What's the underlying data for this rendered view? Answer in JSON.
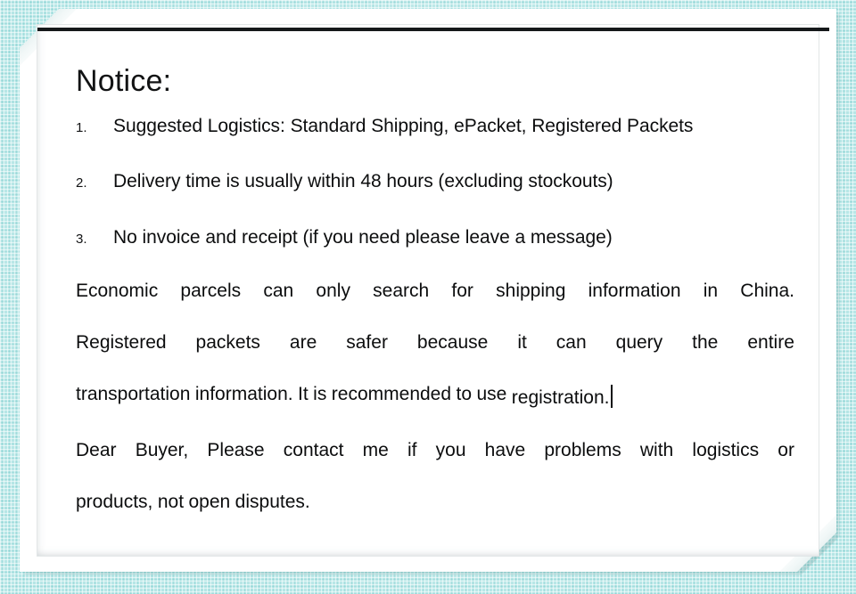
{
  "background": {
    "color": "#b6e6e6",
    "texture": "woven-grid"
  },
  "card": {
    "color": "#ffffff",
    "corner_style": "chamfered-top-left-bottom-right"
  },
  "divider": {
    "color": "#15181a"
  },
  "notice": {
    "title": "Notice:",
    "numbered_items": [
      {
        "marker": "1.",
        "text": "Suggested Logistics: Standard Shipping, ePacket, Registered Packets"
      },
      {
        "marker": "2.",
        "text": "Delivery time is usually within 48 hours (excluding stockouts)"
      },
      {
        "marker": "3.",
        "text": "No invoice and receipt (if you need please leave a message)"
      }
    ],
    "paragraph_lines": [
      {
        "align": "justify",
        "words": [
          "Economic",
          "parcels",
          "can",
          "only",
          "search",
          "for",
          "shipping",
          "information",
          "in",
          "China."
        ]
      },
      {
        "align": "justify",
        "words": [
          "Registered",
          "packets",
          "are",
          "safer",
          "because",
          "it",
          "can",
          "query",
          "the",
          "entire"
        ]
      },
      {
        "align": "flush",
        "words": [
          "transportation",
          "information.",
          "It",
          "is",
          "recommended",
          "to",
          "use",
          "registration."
        ],
        "caret": true
      },
      {
        "align": "justify",
        "words": [
          "Dear",
          "Buyer,",
          "Please",
          "contact",
          "me",
          "if",
          "you",
          "have",
          "problems",
          "with",
          "logistics",
          "or"
        ]
      },
      {
        "align": "flush",
        "words": [
          "products,",
          "not",
          "open",
          "disputes."
        ]
      }
    ]
  }
}
